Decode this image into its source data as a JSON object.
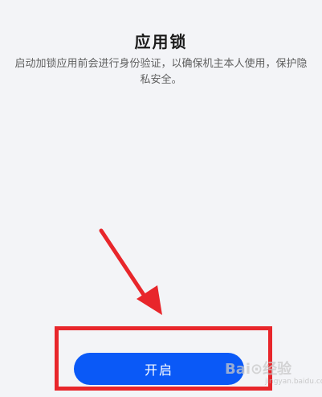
{
  "page": {
    "title": "应用锁",
    "description": "启动加锁应用前会进行身份验证，以确保机主本人使用，保护隐私安全。"
  },
  "actions": {
    "enable_label": "开启"
  },
  "watermark": {
    "text": "Bai⊙经验",
    "sub": "jingyan.baidu.com"
  },
  "colors": {
    "accent": "#0a59f7",
    "annotation": "#e8262b",
    "background": "#f3f4f7"
  }
}
